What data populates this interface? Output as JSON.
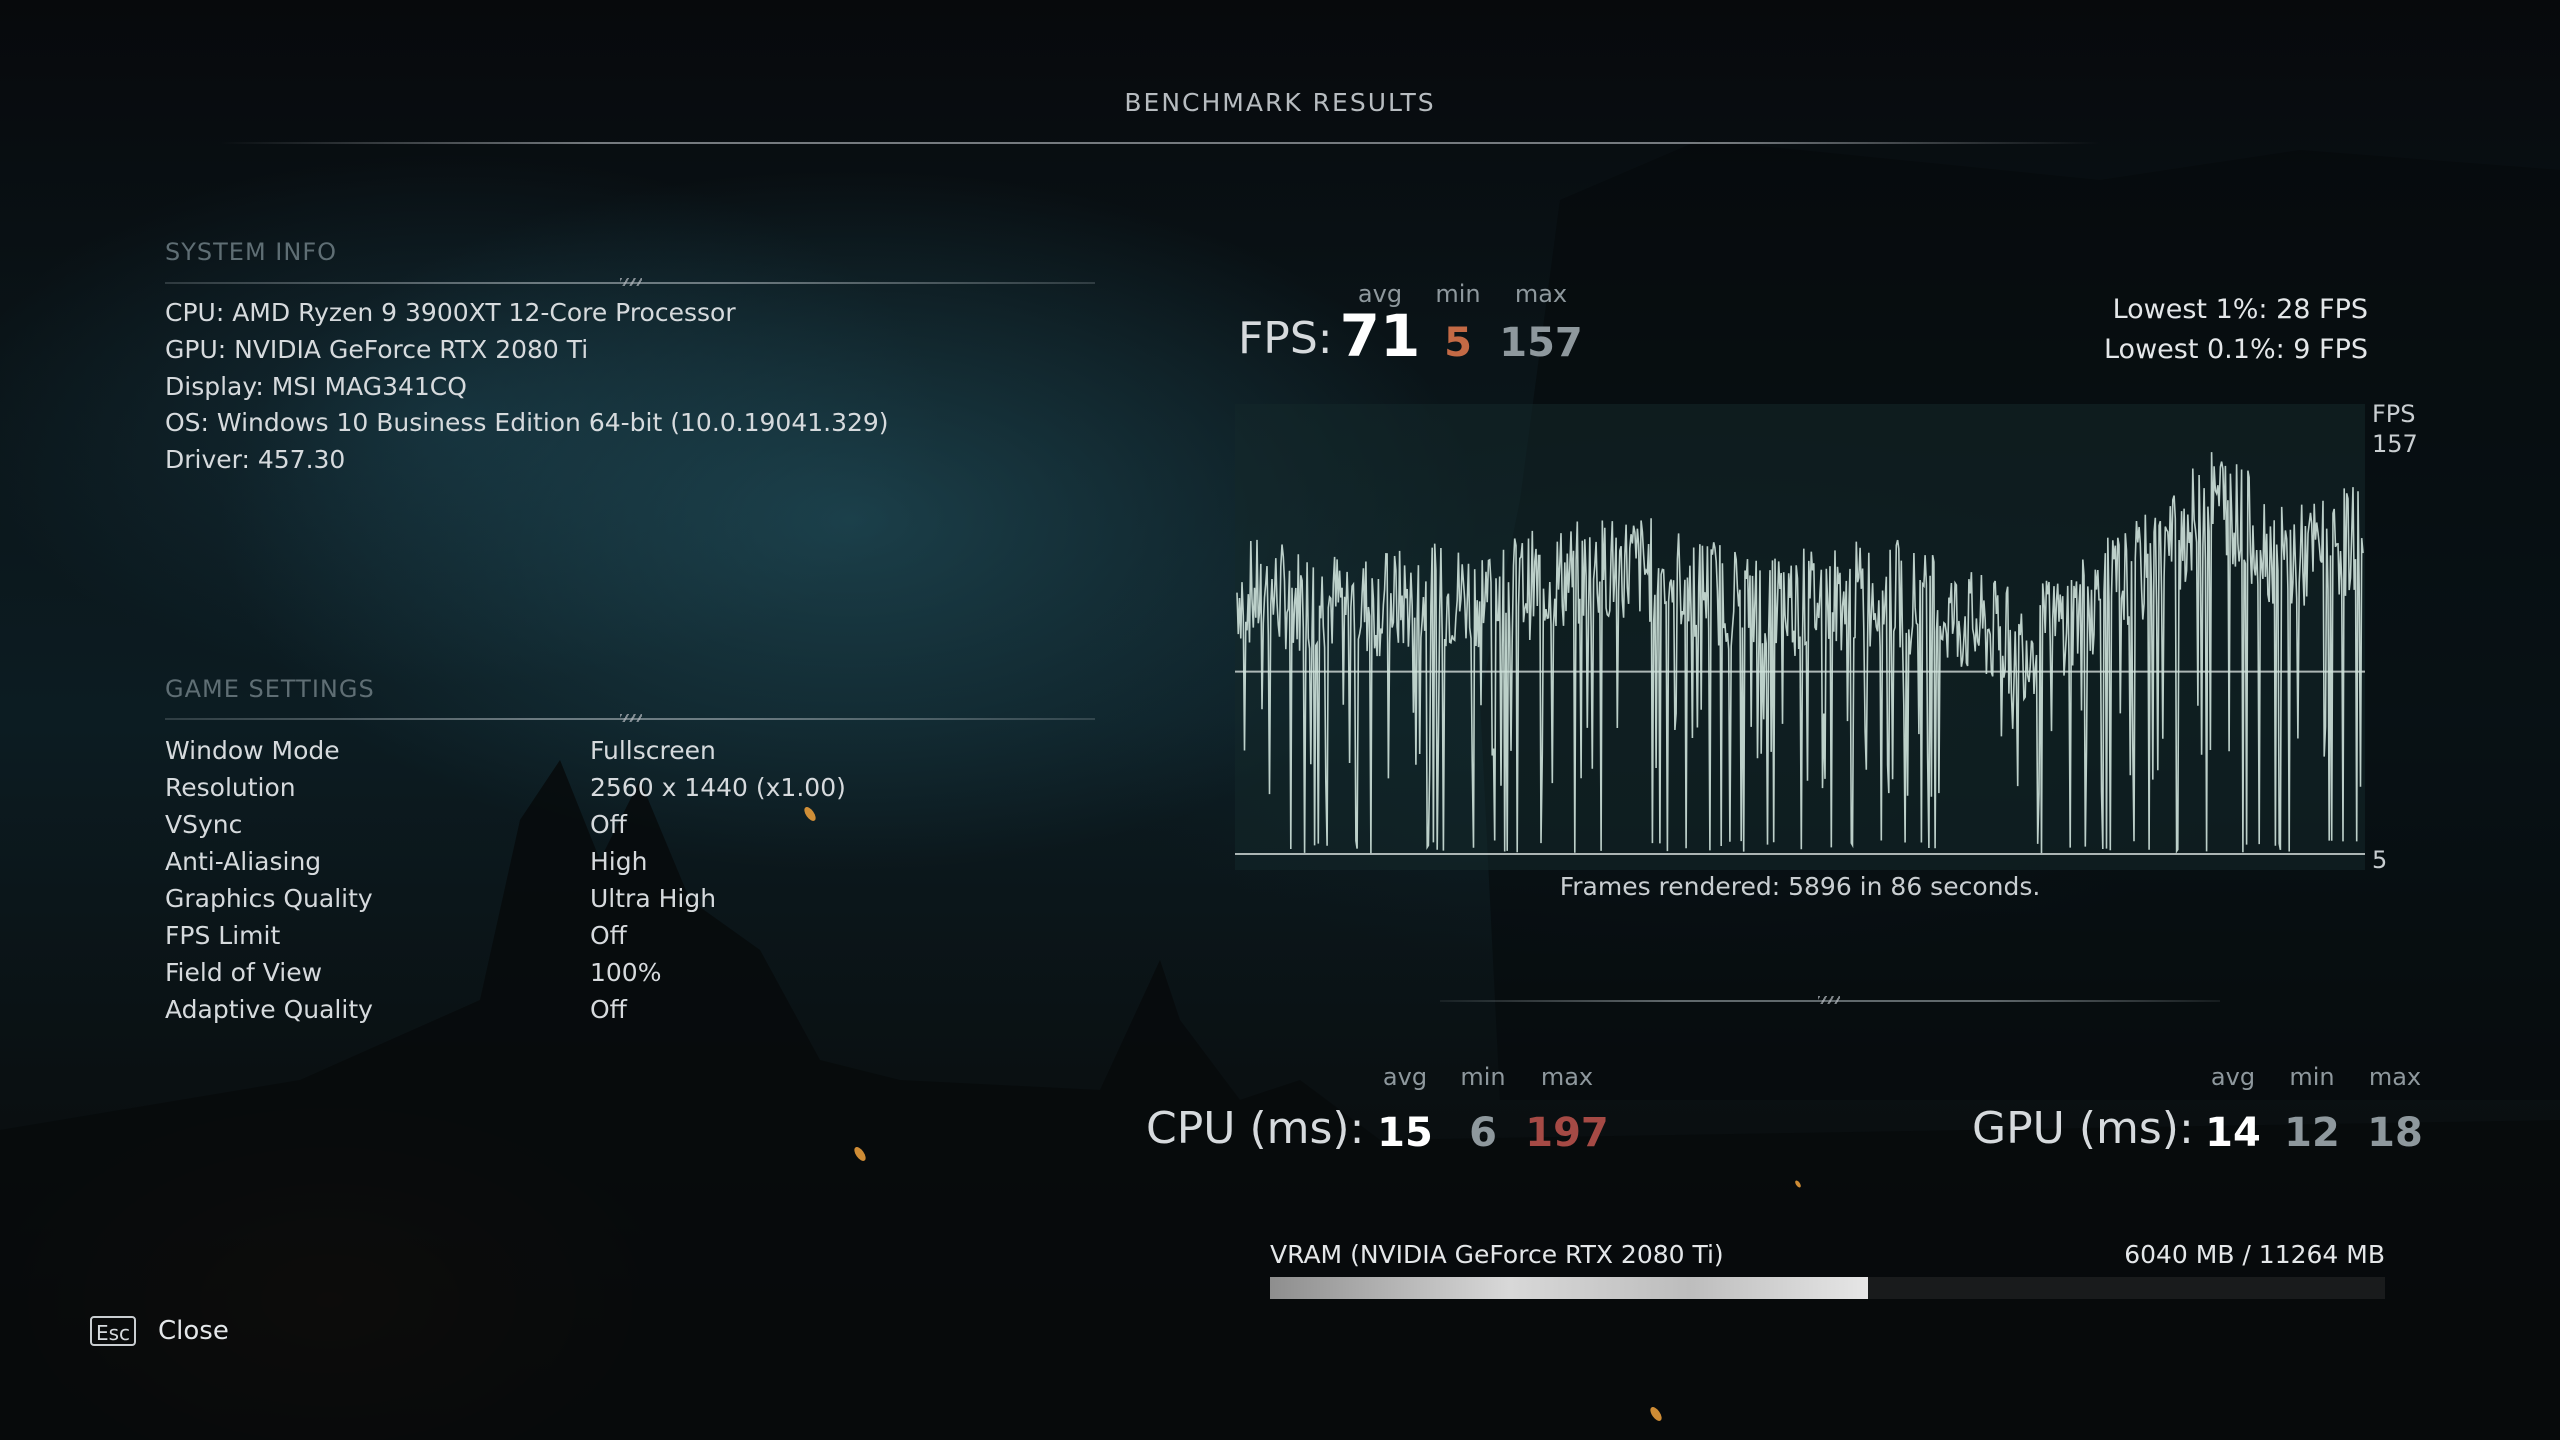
{
  "title": "BENCHMARK RESULTS",
  "system_info": {
    "heading": "SYSTEM INFO",
    "lines": [
      "CPU: AMD Ryzen 9 3900XT 12-Core Processor",
      "GPU: NVIDIA GeForce RTX 2080 Ti",
      "Display: MSI MAG341CQ",
      "OS: Windows 10 Business Edition 64-bit (10.0.19041.329)",
      "Driver: 457.30"
    ]
  },
  "game_settings": {
    "heading": "GAME SETTINGS",
    "rows": [
      {
        "label": "Window Mode",
        "value": "Fullscreen"
      },
      {
        "label": "Resolution",
        "value": "2560 x 1440 (x1.00)"
      },
      {
        "label": "VSync",
        "value": "Off"
      },
      {
        "label": "Anti-Aliasing",
        "value": "High"
      },
      {
        "label": "Graphics Quality",
        "value": "Ultra High"
      },
      {
        "label": "FPS Limit",
        "value": "Off"
      },
      {
        "label": "Field of View",
        "value": "100%"
      },
      {
        "label": "Adaptive Quality",
        "value": "Off"
      }
    ]
  },
  "stat_headers": {
    "avg": "avg",
    "min": "min",
    "max": "max"
  },
  "fps": {
    "label": "FPS:",
    "avg": "71",
    "min": "5",
    "max": "157",
    "lowest_1": "Lowest 1%: 28 FPS",
    "lowest_01": "Lowest 0.1%: 9 FPS"
  },
  "chart_data": {
    "type": "line",
    "title": "",
    "xlabel": "",
    "ylabel": "FPS",
    "ylim": [
      5,
      157
    ],
    "y_top_label": "157",
    "y_bottom_label": "5",
    "avg_line": 71,
    "approx_profile": [
      {
        "t": 0,
        "fps": 100
      },
      {
        "t": 10,
        "fps": 95
      },
      {
        "t": 20,
        "fps": 100
      },
      {
        "t": 30,
        "fps": 110
      },
      {
        "t": 40,
        "fps": 95
      },
      {
        "t": 50,
        "fps": 100
      },
      {
        "t": 60,
        "fps": 80
      },
      {
        "t": 70,
        "fps": 110
      },
      {
        "t": 75,
        "fps": 135
      },
      {
        "t": 80,
        "fps": 110
      },
      {
        "t": 86,
        "fps": 120
      }
    ],
    "frames_rendered": "Frames rendered: 5896 in 86 seconds."
  },
  "cpu": {
    "label": "CPU (ms):",
    "avg": "15",
    "min": "6",
    "max": "197"
  },
  "gpu": {
    "label": "GPU (ms):",
    "avg": "14",
    "min": "12",
    "max": "18"
  },
  "vram": {
    "label": "VRAM (NVIDIA GeForce RTX 2080 Ti)",
    "value": "6040 MB / 11264 MB",
    "used_mb": 6040,
    "total_mb": 11264
  },
  "footer": {
    "key": "Esc",
    "close": "Close"
  },
  "colors": {
    "min_orange": "#c46a45",
    "max_red": "#a54a45",
    "muted": "#8e989d",
    "chart_line": "#cfe3dc"
  }
}
